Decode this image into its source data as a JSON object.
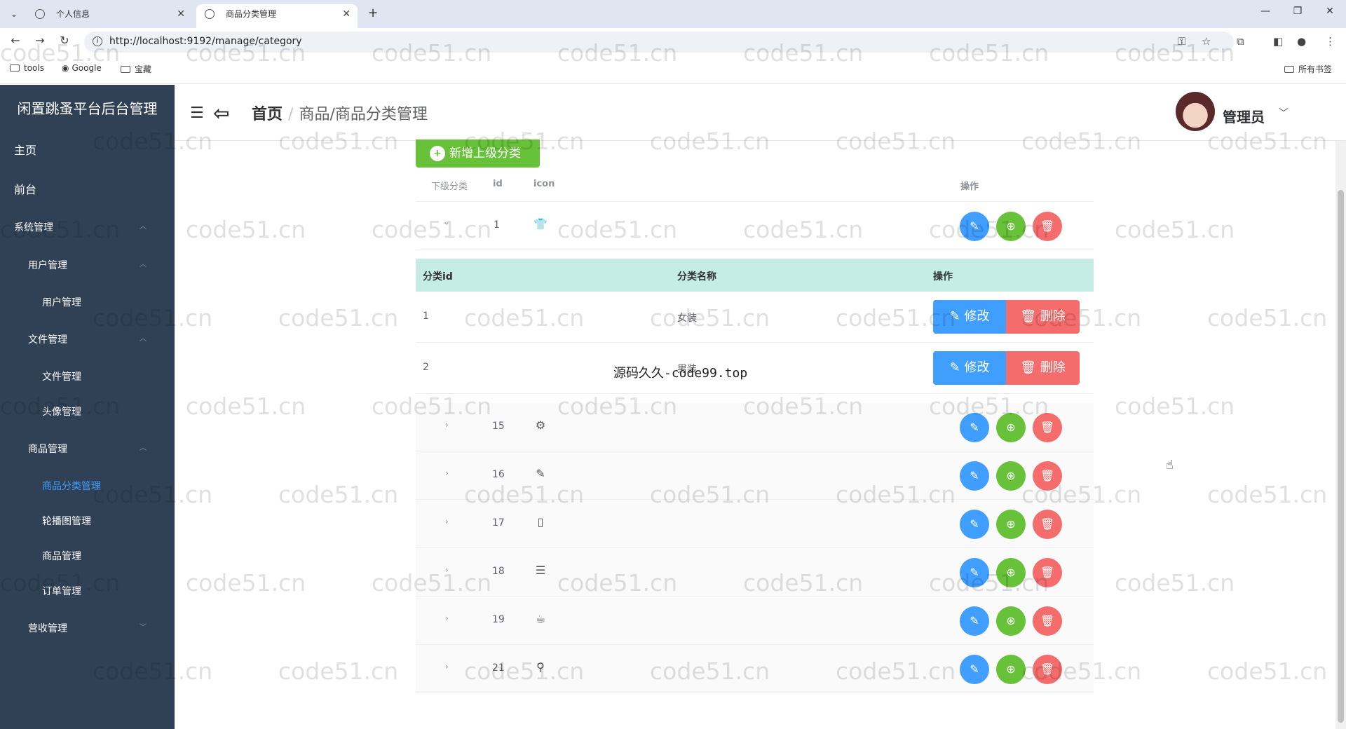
{
  "browser": {
    "tabs": [
      {
        "label": "个人信息"
      },
      {
        "label": "商品分类管理"
      }
    ],
    "new_tab": "+",
    "url": "http://localhost:9192/manage/category",
    "bookmarks": [
      "tools",
      "Google",
      "宝藏"
    ],
    "all_bookmarks": "所有书签"
  },
  "sidebar": {
    "title": "闲置跳蚤平台后台管理",
    "items": [
      {
        "label": "主页"
      },
      {
        "label": "前台"
      },
      {
        "label": "系统管理"
      },
      {
        "label": "用户管理"
      },
      {
        "label": "用户管理"
      },
      {
        "label": "文件管理"
      },
      {
        "label": "文件管理"
      },
      {
        "label": "头像管理"
      },
      {
        "label": "商品管理"
      },
      {
        "label": "商品分类管理"
      },
      {
        "label": "轮播图管理"
      },
      {
        "label": "商品管理"
      },
      {
        "label": "订单管理"
      },
      {
        "label": "营收管理"
      }
    ]
  },
  "header": {
    "breadcrumb_home": "首页",
    "breadcrumb_sep": "/",
    "breadcrumb_current": "商品/商品分类管理",
    "user": "管理员"
  },
  "main": {
    "add_button": "新增上级分类",
    "columns": {
      "sub": "下级分类",
      "id": "id",
      "icon": "icon",
      "ops": "操作"
    },
    "rows": [
      {
        "id": "1",
        "icon": "shirt-icon"
      },
      {
        "id": "15",
        "icon": "gear-icon"
      },
      {
        "id": "16",
        "icon": "edit-icon"
      },
      {
        "id": "17",
        "icon": "phone-icon"
      },
      {
        "id": "18",
        "icon": "list-icon"
      },
      {
        "id": "19",
        "icon": "cup-icon"
      },
      {
        "id": "21",
        "icon": "bike-icon"
      }
    ],
    "sub_table": {
      "columns": {
        "id": "分类id",
        "name": "分类名称",
        "ops": "操作"
      },
      "rows": [
        {
          "id": "1",
          "name": "女装"
        },
        {
          "id": "2",
          "name": "男装"
        }
      ],
      "edit_label": "修改",
      "delete_label": "删除"
    }
  },
  "overlay_text": "源码久久-code99.top",
  "watermark": "code51.cn",
  "colors": {
    "sidebar_bg": "#304156",
    "primary": "#409eff",
    "success": "#67c23a",
    "danger": "#f56c6c",
    "active": "#409eff"
  }
}
